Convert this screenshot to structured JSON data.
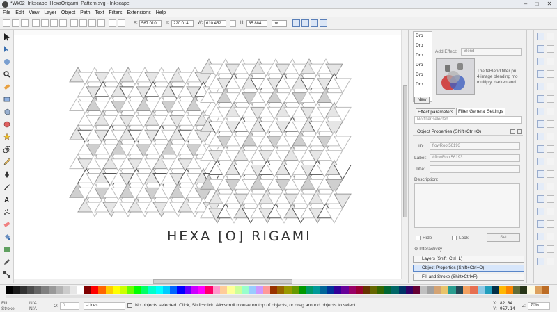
{
  "window": {
    "title": "*Wk02_Inkscape_HexaOrigami_Pattern.svg - Inkscape",
    "minimize": "–",
    "maximize": "□",
    "close": "✕"
  },
  "menu": [
    "File",
    "Edit",
    "View",
    "Layer",
    "Object",
    "Path",
    "Text",
    "Filters",
    "Extensions",
    "Help"
  ],
  "controls": {
    "x_label": "X:",
    "x_value": "567.010",
    "y_label": "Y:",
    "y_value": "220.014",
    "w_label": "W:",
    "w_value": "610.452",
    "h_label": "H:",
    "h_value": "35.884",
    "unit": "px"
  },
  "canvas": {
    "artwork_text": "HEXA [O] RIGAMI"
  },
  "filter_panel": {
    "list_items": [
      "Dro",
      "Dro",
      "Dro",
      "Dro",
      "Dro",
      "Dro"
    ],
    "add_effect_label": "Add Effect:",
    "add_effect_value": "Blend",
    "desc_lines": [
      "The feBlend filter pri",
      "4 image blending mo",
      "multiply, darken and"
    ],
    "desc_bold": "feBlend",
    "new_button": "New",
    "tab_effect": "Effect parameters",
    "tab_general": "Filter General Settings",
    "no_filter": "No filter selected"
  },
  "object_properties": {
    "header": "Object Properties (Shift+Ctrl+O)",
    "id_label": "ID:",
    "id_value": "flowRoot56193",
    "label_label": "Label:",
    "label_value": "#flowRoot56193",
    "title_label": "Title:",
    "description_label": "Description:",
    "hide_label": "Hide",
    "lock_label": "Lock",
    "set_button": "Set",
    "interactivity": "Interactivity"
  },
  "dock_tabs": [
    "Layers (Shift+Ctrl+L)",
    "Object Properties (Shift+Ctrl+O)",
    "Fill and Stroke (Shift+Ctrl+F)"
  ],
  "status": {
    "fill_label": "Fill:",
    "fill_value": "N/A",
    "stroke_label": "Stroke:",
    "stroke_value": "N/A",
    "opacity_label": "O:",
    "opacity_value": "0",
    "layer": "-Lines",
    "message": "No objects selected. Click, Shift+click, Alt+scroll mouse on top of objects, or drag around objects to select.",
    "x_label": "X:",
    "x_value": "82.84",
    "y_label": "Y:",
    "y_value": "957.14",
    "z_label": "Z:",
    "zoom": "70%"
  },
  "palette_colors": [
    "#000000",
    "#1a1a1a",
    "#333333",
    "#4d4d4d",
    "#666666",
    "#808080",
    "#999999",
    "#b3b3b3",
    "#cccccc",
    "#e6e6e6",
    "#ffffff",
    "#800000",
    "#ff0000",
    "#ff6600",
    "#ffcc00",
    "#ffff00",
    "#ccff00",
    "#66ff00",
    "#00ff00",
    "#00ff66",
    "#00ffcc",
    "#00ffff",
    "#00ccff",
    "#0066ff",
    "#0000ff",
    "#6600ff",
    "#cc00ff",
    "#ff00ff",
    "#ff0066",
    "#ff99cc",
    "#ffcc99",
    "#ffff99",
    "#ccff99",
    "#99ffcc",
    "#99ccff",
    "#cc99ff",
    "#ff9999",
    "#993300",
    "#996600",
    "#999900",
    "#669900",
    "#009900",
    "#009966",
    "#009999",
    "#006699",
    "#003399",
    "#330099",
    "#660099",
    "#990066",
    "#990033",
    "#663300",
    "#666600",
    "#336600",
    "#006633",
    "#006666",
    "#003366",
    "#330066",
    "#660033",
    "#c0c0c0",
    "#a0a0a0",
    "#d4a373",
    "#e9c46a",
    "#2a9d8f",
    "#264653",
    "#f4a261",
    "#e76f51",
    "#8ecae6",
    "#219ebc",
    "#023047",
    "#ffb703",
    "#fb8500",
    "#606c38",
    "#283618",
    "#fefae0",
    "#dda15e",
    "#bc6c25"
  ]
}
